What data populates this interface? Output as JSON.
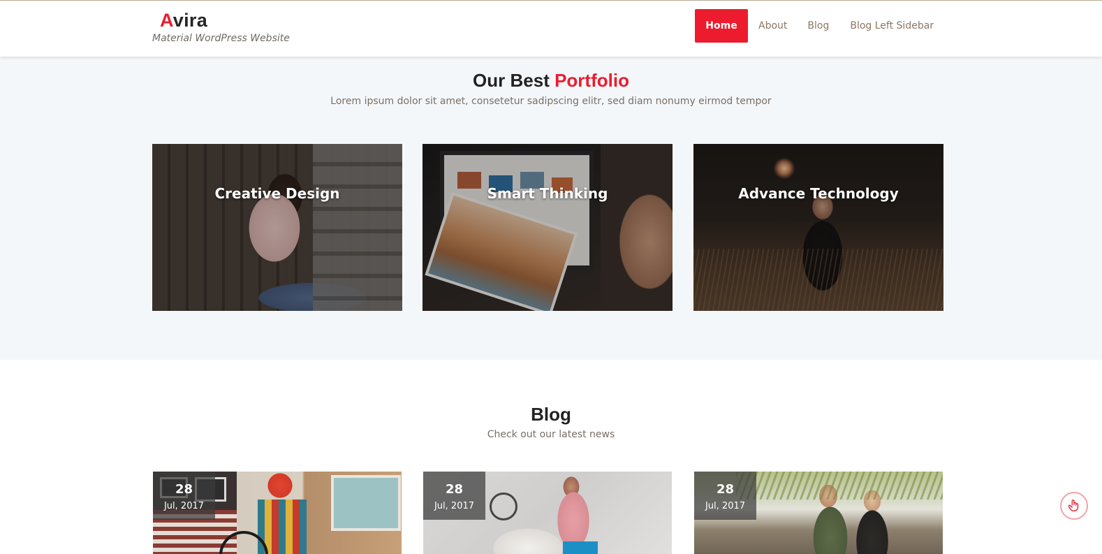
{
  "site": {
    "logo_first": "A",
    "logo_rest": "vira",
    "tagline": "Material WordPress Website"
  },
  "nav": {
    "items": [
      {
        "label": "Home",
        "active": true
      },
      {
        "label": "About"
      },
      {
        "label": "Blog"
      },
      {
        "label": "Blog Left Sidebar"
      }
    ]
  },
  "portfolio": {
    "title_plain": "Our Best ",
    "title_accent": "Portfolio",
    "subtitle": "Lorem ipsum dolor sit amet, consetetur sadipscing elitr, sed diam nonumy eirmod tempor",
    "cards": [
      {
        "title": "Creative Design"
      },
      {
        "title": "Smart Thinking"
      },
      {
        "title": "Advance Technology"
      }
    ]
  },
  "blog": {
    "title": "Blog",
    "subtitle": "Check out our latest news",
    "posts": [
      {
        "day": "28",
        "month": "Jul, 2017"
      },
      {
        "day": "28",
        "month": "Jul, 2017"
      },
      {
        "day": "28",
        "month": "Jul, 2017"
      }
    ]
  },
  "colors": {
    "accent": "#ec1c2e",
    "section_bg": "#f4f7fa"
  },
  "icons": {
    "floating_button": "pointer-hand-icon"
  }
}
